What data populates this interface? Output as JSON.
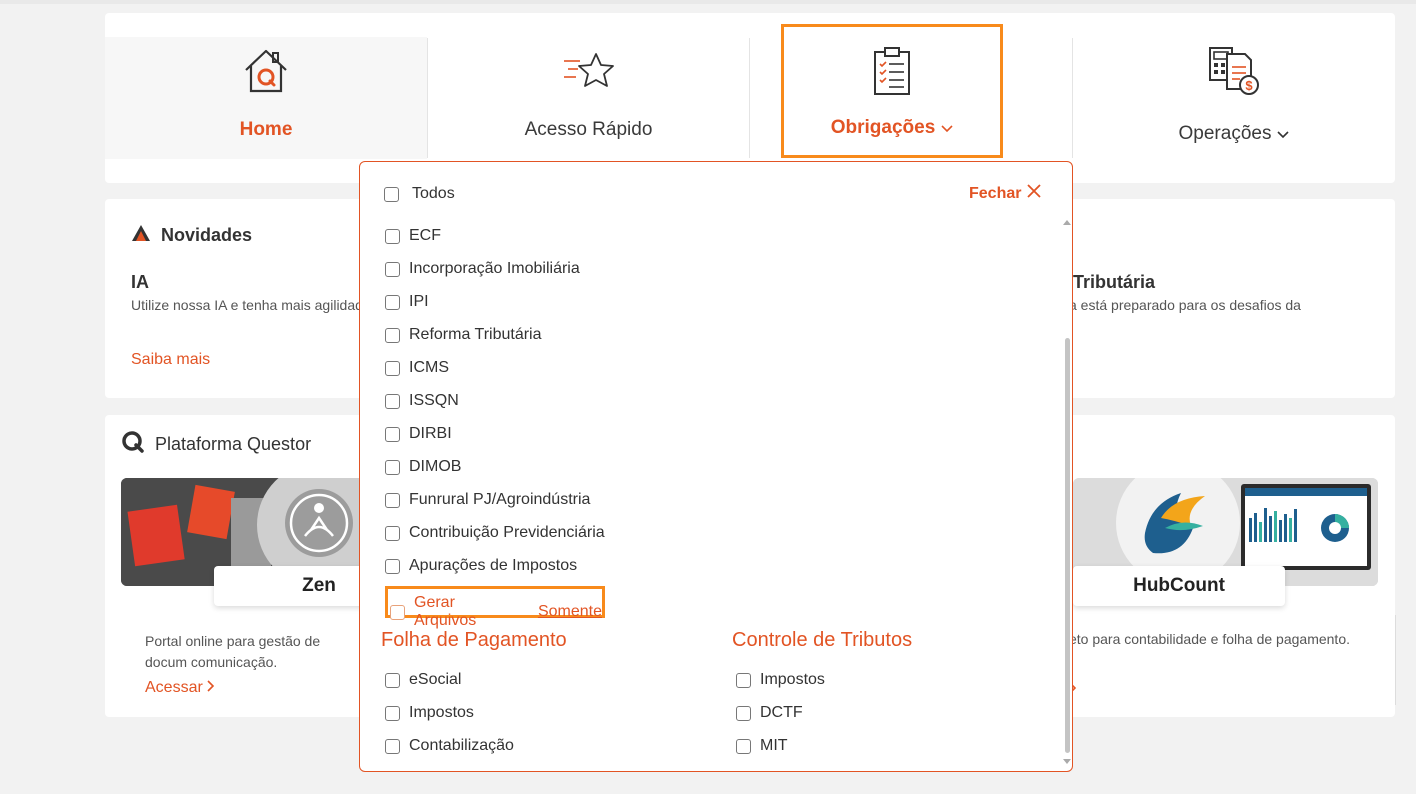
{
  "nav": {
    "items": [
      {
        "label": "Home",
        "icon": "house-icon"
      },
      {
        "label": "Acesso Rápido",
        "icon": "star-icon"
      },
      {
        "label": "Obrigações",
        "icon": "clipboard-checklist-icon"
      },
      {
        "label": "Operações",
        "icon": "calculator-document-icon"
      }
    ]
  },
  "novidades": {
    "heading": "Novidades",
    "item1_title": "IA",
    "item1_desc": "Utilize nossa IA e tenha mais agilidad",
    "item1_link": "Saiba mais",
    "item2_title": "Tributária",
    "item2_desc": "a está preparado para os desafios da"
  },
  "plataforma": {
    "heading": "Plataforma Questor",
    "zen_label": "Zen",
    "zen_desc": "Portal online para gestão de docum comunicação.",
    "zen_link": "Acessar",
    "hub_label": "HubCount",
    "hub_desc": "eto para contabilidade e folha de pagamento."
  },
  "dropdown": {
    "todos": "Todos",
    "fechar": "Fechar",
    "items": [
      "ECF",
      "Incorporação Imobiliária",
      "IPI",
      "Reforma Tributária",
      "ICMS",
      "ISSQN",
      "DIRBI",
      "DIMOB",
      "Funrural PJ/Agroindústria",
      "Contribuição Previdenciária",
      "Apurações de Impostos"
    ],
    "gerar_label": "Gerar Arquivos",
    "gerar_link": "Somente",
    "folha": {
      "title": "Folha de Pagamento",
      "items": [
        "eSocial",
        "Impostos",
        "Contabilização"
      ]
    },
    "controle": {
      "title": "Controle de Tributos",
      "items": [
        "Impostos",
        "DCTF",
        "MIT"
      ]
    }
  },
  "colors": {
    "accent": "#e25424",
    "highlight_border": "#f88a1b"
  }
}
